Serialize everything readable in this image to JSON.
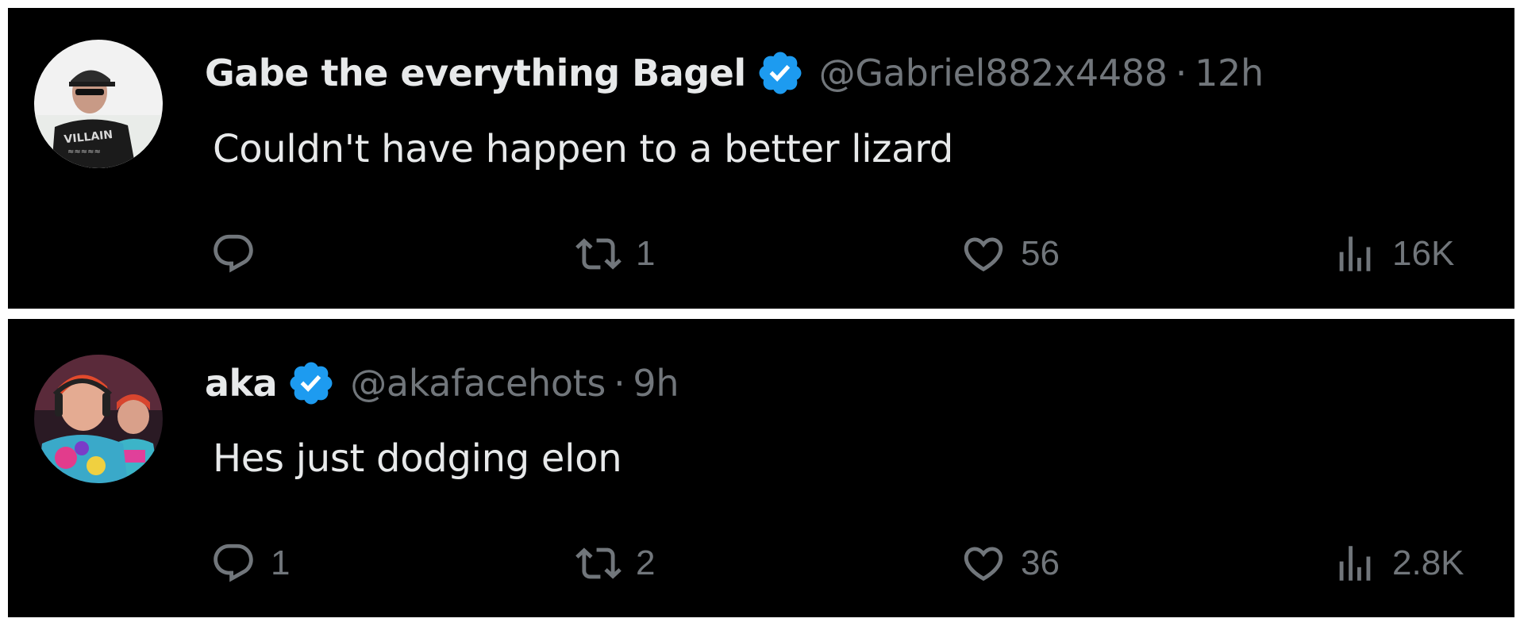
{
  "tweets": [
    {
      "display_name": "Gabe the everything Bagel",
      "handle": "@Gabriel882x4488",
      "separator": "·",
      "time": "12h",
      "text": "Couldn't have happen to a better lizard",
      "replies": "",
      "retweets": "1",
      "likes": "56",
      "views": "16K",
      "avatar_shirt_text": "VILLAIN"
    },
    {
      "display_name": "aka",
      "handle": "@akafacehots",
      "separator": "·",
      "time": "9h",
      "text": "Hes just dodging elon",
      "replies": "1",
      "retweets": "2",
      "likes": "36",
      "views": "2.8K"
    }
  ],
  "icons": {
    "verified": "verified-badge-icon",
    "reply": "reply-icon",
    "retweet": "retweet-icon",
    "like": "heart-icon",
    "views": "views-icon"
  },
  "colors": {
    "background": "#000000",
    "text": "#e7e9ea",
    "secondary": "#71767b",
    "verified": "#1d9bf0",
    "frame": "#ffffff"
  }
}
